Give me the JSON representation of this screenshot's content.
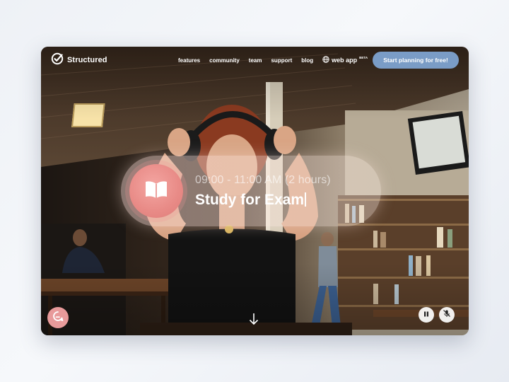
{
  "brand": {
    "name": "Structured"
  },
  "nav": {
    "links": [
      "features",
      "community",
      "team",
      "support",
      "blog"
    ],
    "webapp_label": "web app",
    "webapp_badge": "BETA",
    "cta_label": "Start planning for free!"
  },
  "task": {
    "time": "09:00 - 11:00 AM (2 hours)",
    "title": "Study for Exam",
    "icon": "open-book-icon"
  },
  "controls": {
    "chat_icon": "chat-bubble-icon",
    "scroll_icon": "arrow-down-icon",
    "pause_icon": "pause-icon",
    "mute_icon": "muted-microphone-icon"
  },
  "colors": {
    "cta": "#7a9cc6",
    "task_icon": "#e88a86",
    "chat_button": "#e89a9a",
    "page_background": "#eef1f6"
  }
}
